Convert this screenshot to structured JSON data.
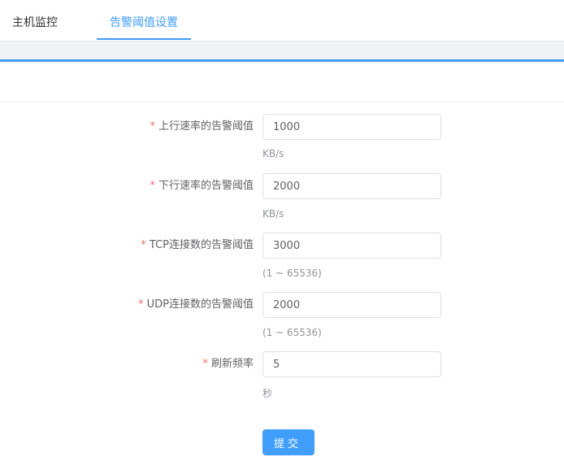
{
  "tabs": [
    {
      "label": "主机监控",
      "active": false
    },
    {
      "label": "告警阈值设置",
      "active": true
    }
  ],
  "form": {
    "required_mark": "*",
    "fields": [
      {
        "label": "上行速率的告警阈值",
        "value": "1000",
        "hint": "KB/s"
      },
      {
        "label": "下行速率的告警阈值",
        "value": "2000",
        "hint": "KB/s"
      },
      {
        "label": "TCP连接数的告警阈值",
        "value": "3000",
        "hint": "(1 ~ 65536)"
      },
      {
        "label": "UDP连接数的告警阈值",
        "value": "2000",
        "hint": "(1 ~ 65536)"
      },
      {
        "label": "刷新频率",
        "value": "5",
        "hint": "秒"
      }
    ],
    "submit_label": "提交"
  },
  "colors": {
    "primary": "#409eff",
    "required": "#f56c6c"
  }
}
